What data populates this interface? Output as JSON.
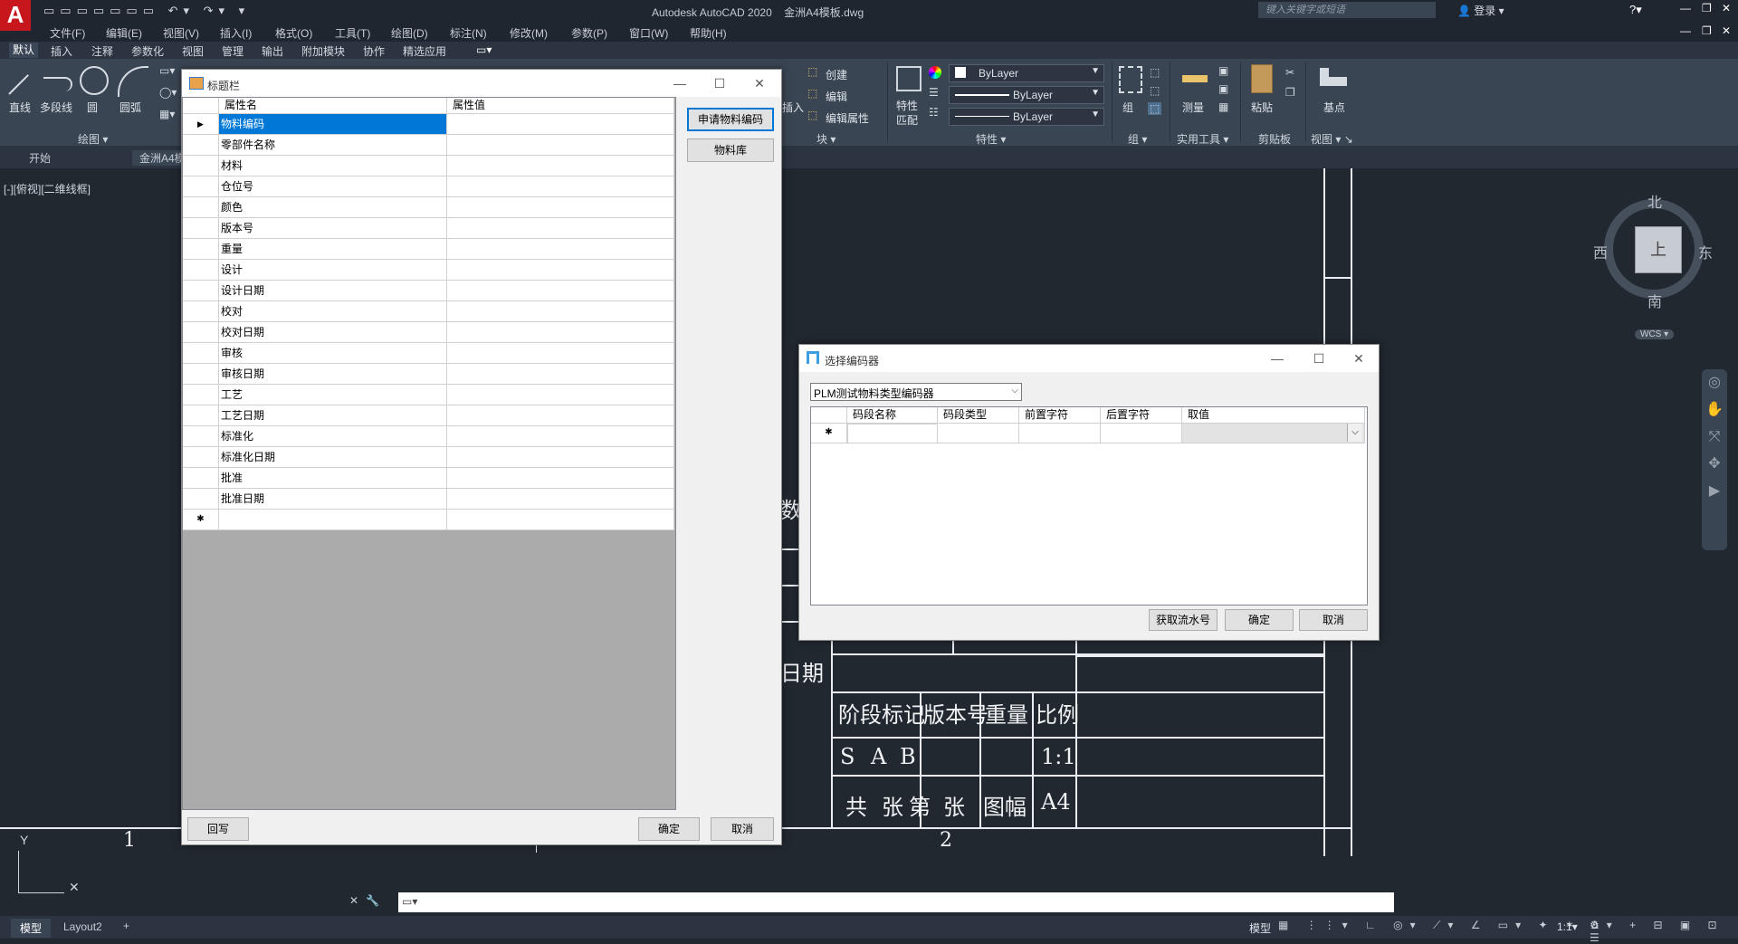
{
  "app": {
    "title": "Autodesk AutoCAD 2020",
    "file": "金洲A4模板.dwg",
    "search_placeholder": "键入关键字或短语",
    "login": "登录"
  },
  "menu": [
    "文件(F)",
    "编辑(E)",
    "视图(V)",
    "插入(I)",
    "格式(O)",
    "工具(T)",
    "绘图(D)",
    "标注(N)",
    "修改(M)",
    "参数(P)",
    "窗口(W)",
    "帮助(H)"
  ],
  "ribbon_tabs": [
    "默认",
    "插入",
    "注释",
    "参数化",
    "视图",
    "管理",
    "输出",
    "附加模块",
    "协作",
    "精选应用"
  ],
  "ribbon": {
    "draw": {
      "line": "直线",
      "polyline": "多段线",
      "circle": "圆",
      "arc": "圆弧",
      "title": "绘图"
    },
    "block": {
      "insert": "插入",
      "create": "创建",
      "edit": "编辑",
      "edit_attr": "编辑属性",
      "title": "块"
    },
    "properties": {
      "match": "特性",
      "match2": "匹配",
      "layer1": "ByLayer",
      "layer2": "ByLayer",
      "layer3": "ByLayer",
      "title": "特性"
    },
    "group": {
      "label": "组",
      "title": "组"
    },
    "utilities": {
      "measure": "测量",
      "title": "实用工具"
    },
    "clipboard": {
      "paste": "粘贴",
      "title": "剪贴板"
    },
    "view": {
      "basepoint": "基点",
      "title": "视图"
    }
  },
  "doc_tabs": {
    "start": "开始",
    "file": "金洲A4模"
  },
  "viewport_label": "[-][俯视][二维线框]",
  "viewcube": {
    "north": "北",
    "south": "南",
    "east": "东",
    "west": "西",
    "top": "上",
    "wcs": "WCS"
  },
  "drawing": {
    "ruler1": "1",
    "ruler2": "2",
    "shu": "数",
    "riqi": "日期",
    "row1": [
      "阶段标记",
      "版本号",
      "重量",
      "比例"
    ],
    "row2": [
      "S",
      "A",
      "B",
      "1:1"
    ],
    "row3": [
      "共",
      "张",
      "第",
      "张",
      "图幅",
      "A4"
    ],
    "ucs_y": "Y"
  },
  "dialog_title": {
    "title": "标题栏",
    "col_name": "属性名",
    "col_value": "属性值",
    "rows": [
      "物料编码",
      "零部件名称",
      "材料",
      "仓位号",
      "颜色",
      "版本号",
      "重量",
      "设计",
      "设计日期",
      "校对",
      "校对日期",
      "审核",
      "审核日期",
      "工艺",
      "工艺日期",
      "标准化",
      "标准化日期",
      "批准",
      "批准日期"
    ],
    "btn_apply": "申请物料编码",
    "btn_lib": "物料库",
    "btn_writeback": "回写",
    "btn_ok": "确定",
    "btn_cancel": "取消"
  },
  "dialog_encoder": {
    "title": "选择编码器",
    "select_value": "PLM测试物料类型编码器",
    "cols": [
      "码段名称",
      "码段类型",
      "前置字符",
      "后置字符",
      "取值"
    ],
    "btn_serial": "获取流水号",
    "btn_ok": "确定",
    "btn_cancel": "取消"
  },
  "status": {
    "model": "模型",
    "model_tab": "模型",
    "layout": "Layout2",
    "scale": "1:1"
  },
  "colors": {
    "accent": "#0078d7",
    "canvas": "#212830",
    "ribbon": "#3a4554"
  }
}
